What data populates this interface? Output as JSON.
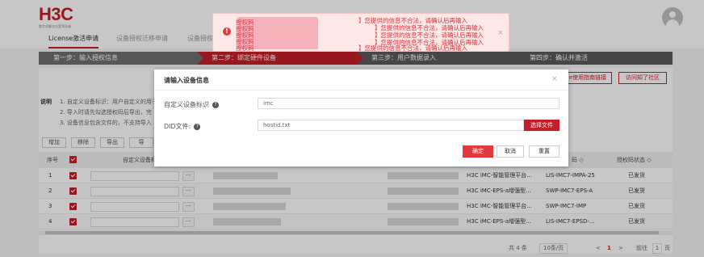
{
  "header": {
    "logo": "H3C",
    "logo_subtitle": "数字化解决方案领导者",
    "tabs": [
      "License激活申请",
      "设备授权迁移申请",
      "设备授权"
    ]
  },
  "toast": {
    "prefix": "授权码",
    "message": "】您提供的信息不合法，请确认后再输入",
    "close": "×"
  },
  "steps": [
    "第一步：输入授权信息",
    "第二步：绑定硬件设备",
    "第三步：用户数据录入",
    "第四步：确认并激活"
  ],
  "side_buttons": [
    "e使用指南链接",
    "访问知了社区"
  ],
  "description": {
    "label": "说明",
    "lines": [
      "1. 自定义设备标识：用户自定义的用于",
      "2. 导入时请先勾选授权码后导出，完",
      "3. 设备信息包含文件的，不支持导入"
    ]
  },
  "ops": [
    "增加",
    "移除",
    "导出",
    "导"
  ],
  "table": {
    "headers": {
      "index": "序号",
      "device_id": "自定义设备标",
      "code": "码 ◇",
      "status": "授权码状态 ◇"
    },
    "more": "···",
    "rows": [
      {
        "index": "1",
        "name": "H3C iMC-智能管理平台...",
        "code": "LIS-IMC7-IMPA-25",
        "status": "已发货"
      },
      {
        "index": "2",
        "name": "H3C iMC-EPS-a增强型...",
        "code": "SWP-IMC7-EPS-A",
        "status": "已发货"
      },
      {
        "index": "3",
        "name": "H3C iMC-智能管理平台...",
        "code": "SWP-IMC7-IMP",
        "status": "已发货"
      },
      {
        "index": "4",
        "name": "H3C iMC-EPS-a增强型...",
        "code": "LIS-IMC7-EPSD-...",
        "status": "已发货"
      }
    ]
  },
  "pagination": {
    "total": "共 4 条",
    "per_page": "10条/页",
    "prev": "<",
    "current": "1",
    "next": ">",
    "goto_label": "前往",
    "goto_value": "1",
    "page_suffix": "页"
  },
  "dialog": {
    "title": "请输入设备信息",
    "close": "×",
    "device_id_label": "自定义设备标识",
    "device_id_value": "imc",
    "help": "?",
    "did_label": "DID文件:",
    "did_file": "hostid.txt",
    "select_file": "选择文件",
    "confirm": "确定",
    "cancel": "取消",
    "reset": "重置"
  },
  "colors": {
    "brand": "#c41e28",
    "primary_button": "#e0393e",
    "toast_bg": "#fde8e8",
    "toast_text": "#d9303a",
    "step_inactive": "#5a5a5a"
  }
}
